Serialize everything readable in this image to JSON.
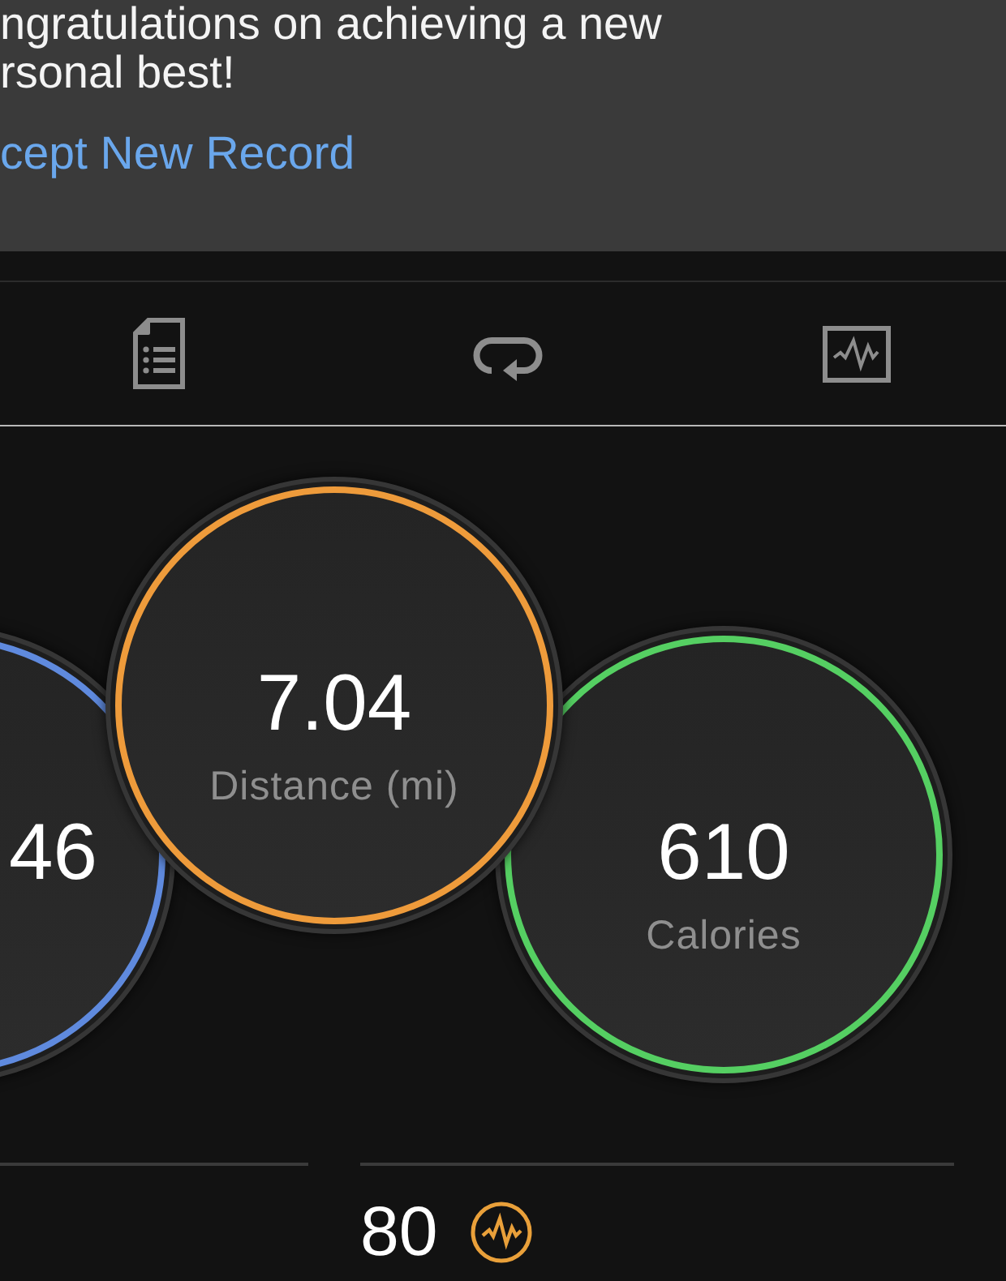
{
  "banner": {
    "message": "ngratulations on achieving a new\nrsonal best!",
    "link": "cept New Record"
  },
  "metrics": [
    {
      "value": "46",
      "color": "#5f8ade"
    },
    {
      "value": "7.04",
      "label": "Distance (mi)",
      "color": "#ee9b3b"
    },
    {
      "value": "610",
      "label": "Calories",
      "color": "#55cf62"
    }
  ],
  "stat": {
    "value": "80"
  }
}
